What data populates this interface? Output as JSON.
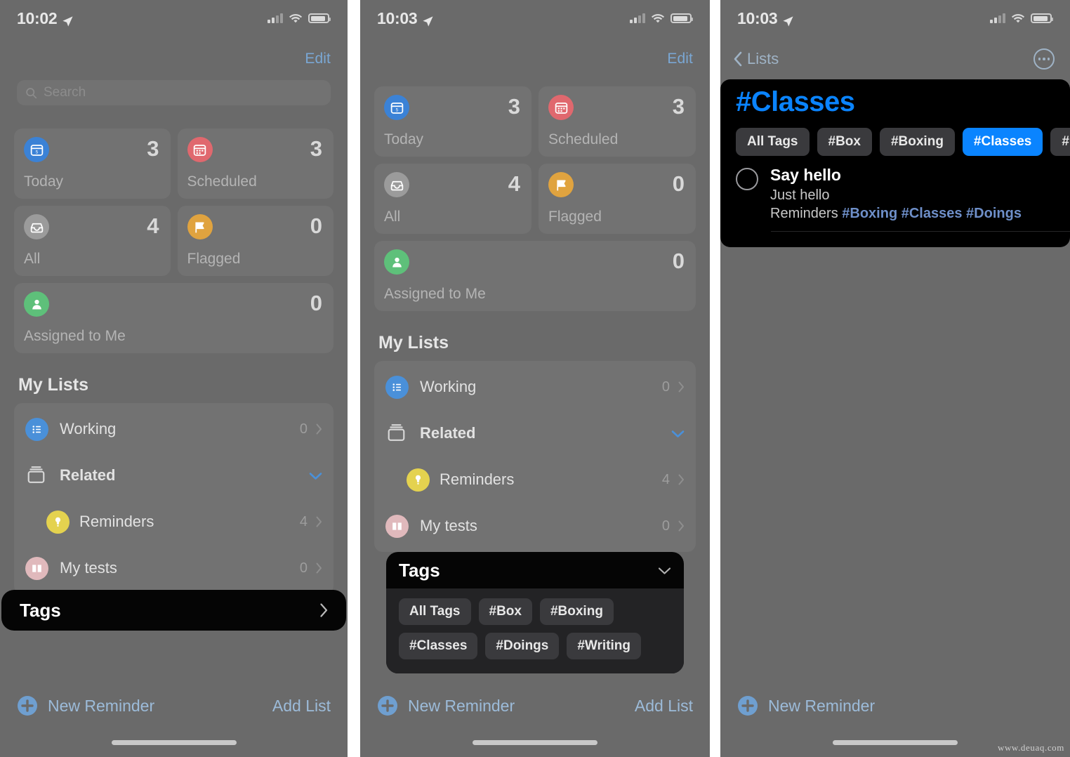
{
  "panels": [
    {
      "status": {
        "time": "10:02",
        "location_icon": "location-arrow-icon",
        "signal_icon": "cellular-bars-icon",
        "wifi_icon": "wifi-icon",
        "battery_icon": "battery-icon"
      },
      "nav": {
        "edit_label": "Edit"
      },
      "search": {
        "placeholder": "Search",
        "icon": "search-icon"
      },
      "smart_cards": [
        {
          "label": "Today",
          "count": "3",
          "icon": "calendar-day-icon",
          "color": "#3b82d6"
        },
        {
          "label": "Scheduled",
          "count": "3",
          "icon": "calendar-icon",
          "color": "#e0686e"
        },
        {
          "label": "All",
          "count": "4",
          "icon": "inbox-tray-icon",
          "color": "#9b9b9b"
        },
        {
          "label": "Flagged",
          "count": "0",
          "icon": "flag-icon",
          "color": "#e0a33f"
        },
        {
          "label": "Assigned to Me",
          "count": "0",
          "icon": "person-icon",
          "color": "#5ec07a"
        }
      ],
      "my_lists": {
        "title": "My Lists",
        "rows": [
          {
            "name": "Working",
            "count": "0",
            "icon": "bulleted-list-icon",
            "color": "#4a90d9",
            "type": "list"
          },
          {
            "name": "Related",
            "count": "",
            "icon": "folder-group-icon",
            "color": "",
            "type": "group"
          },
          {
            "name": "Reminders",
            "count": "4",
            "icon": "reminders-bulb-icon",
            "color": "#e4d24f",
            "type": "list-indent"
          },
          {
            "name": "My tests",
            "count": "0",
            "icon": "book-icon",
            "color": "#e0b9bc",
            "type": "list"
          }
        ]
      },
      "tags_row": {
        "label": "Tags",
        "chevron_icon": "chevron-right-icon",
        "highlighted": true
      },
      "bottom": {
        "new_reminder": "New Reminder",
        "new_reminder_icon": "plus-circle-icon",
        "add_list": "Add List"
      }
    },
    {
      "status": {
        "time": "10:03",
        "location_icon": "location-arrow-icon",
        "signal_icon": "cellular-bars-icon",
        "wifi_icon": "wifi-icon",
        "battery_icon": "battery-icon"
      },
      "nav": {
        "edit_label": "Edit"
      },
      "smart_cards": [
        {
          "label": "Today",
          "count": "3",
          "icon": "calendar-day-icon",
          "color": "#3b82d6"
        },
        {
          "label": "Scheduled",
          "count": "3",
          "icon": "calendar-icon",
          "color": "#e0686e"
        },
        {
          "label": "All",
          "count": "4",
          "icon": "inbox-tray-icon",
          "color": "#9b9b9b"
        },
        {
          "label": "Flagged",
          "count": "0",
          "icon": "flag-icon",
          "color": "#e0a33f"
        },
        {
          "label": "Assigned to Me",
          "count": "0",
          "icon": "person-icon",
          "color": "#5ec07a"
        }
      ],
      "my_lists": {
        "title": "My Lists",
        "rows": [
          {
            "name": "Working",
            "count": "0",
            "icon": "bulleted-list-icon",
            "color": "#4a90d9",
            "type": "list"
          },
          {
            "name": "Related",
            "count": "",
            "icon": "folder-group-icon",
            "color": "",
            "type": "group"
          },
          {
            "name": "Reminders",
            "count": "4",
            "icon": "reminders-bulb-icon",
            "color": "#e4d24f",
            "type": "list-indent"
          },
          {
            "name": "My tests",
            "count": "0",
            "icon": "book-icon",
            "color": "#e0b9bc",
            "type": "list"
          }
        ]
      },
      "tags_panel": {
        "title": "Tags",
        "collapse_icon": "chevron-down-icon",
        "chips": [
          "All Tags",
          "#Box",
          "#Boxing",
          "#Classes",
          "#Doings",
          "#Writing"
        ]
      },
      "bottom": {
        "new_reminder": "New Reminder",
        "new_reminder_icon": "plus-circle-icon",
        "add_list": "Add List"
      }
    },
    {
      "status": {
        "time": "10:03",
        "location_icon": "location-arrow-icon",
        "signal_icon": "cellular-bars-icon",
        "wifi_icon": "wifi-icon",
        "battery_icon": "battery-icon"
      },
      "nav": {
        "back_label": "Lists",
        "back_icon": "chevron-left-icon",
        "more_icon": "ellipsis-circle-icon"
      },
      "tag_view": {
        "title": "#Classes",
        "accent": "#0a84ff",
        "chips": [
          "All Tags",
          "#Box",
          "#Boxing",
          "#Classes",
          "#Doings"
        ],
        "selected_chip": "#Classes",
        "reminder": {
          "checkbox_icon": "circle-checkbox-icon",
          "title": "Say hello",
          "note": "Just hello",
          "list_name": "Reminders",
          "tags": [
            "#Boxing",
            "#Classes",
            "#Doings"
          ]
        }
      },
      "bottom": {
        "new_reminder": "New Reminder",
        "new_reminder_icon": "plus-circle-icon"
      }
    }
  ],
  "watermark": "www.deuaq.com"
}
